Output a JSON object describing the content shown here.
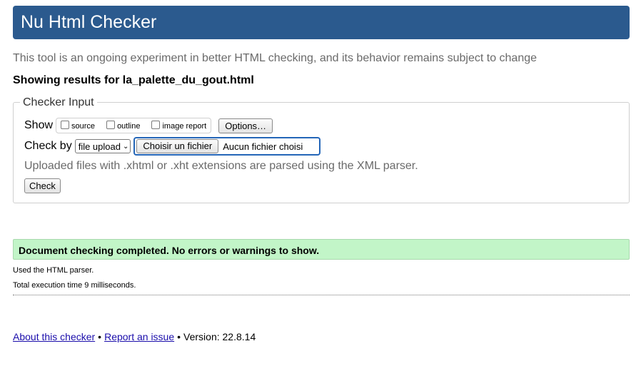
{
  "header": {
    "title": "Nu Html Checker"
  },
  "intro_text": "This tool is an ongoing experiment in better HTML checking, and its behavior remains subject to change",
  "showing_results": "Showing results for la_palette_du_gout.html",
  "checker_input": {
    "legend": "Checker Input",
    "show_label": "Show",
    "show_options": [
      {
        "label": "source",
        "checked": false
      },
      {
        "label": "outline",
        "checked": false
      },
      {
        "label": "image report",
        "checked": false
      }
    ],
    "options_button": "Options…",
    "check_by_label": "Check by",
    "check_by_selected": "file upload",
    "file_button": "Choisir un fichier",
    "file_status": "Aucun fichier choisi",
    "parser_note": "Uploaded files with .xhtml or .xht extensions are parsed using the XML parser.",
    "check_button": "Check"
  },
  "result": {
    "success_message": "Document checking completed. No errors or warnings to show.",
    "parser_used": "Used the HTML parser.",
    "execution_time": "Total execution time 9 milliseconds."
  },
  "footer": {
    "about_link": "About this checker",
    "separator": "•",
    "report_link": "Report an issue",
    "version": "Version: 22.8.14"
  },
  "colors": {
    "header_bg": "#2b5a8e",
    "success_bg": "#c2f5c8",
    "focus_outline": "#2466b8",
    "link": "#1a0dab"
  }
}
